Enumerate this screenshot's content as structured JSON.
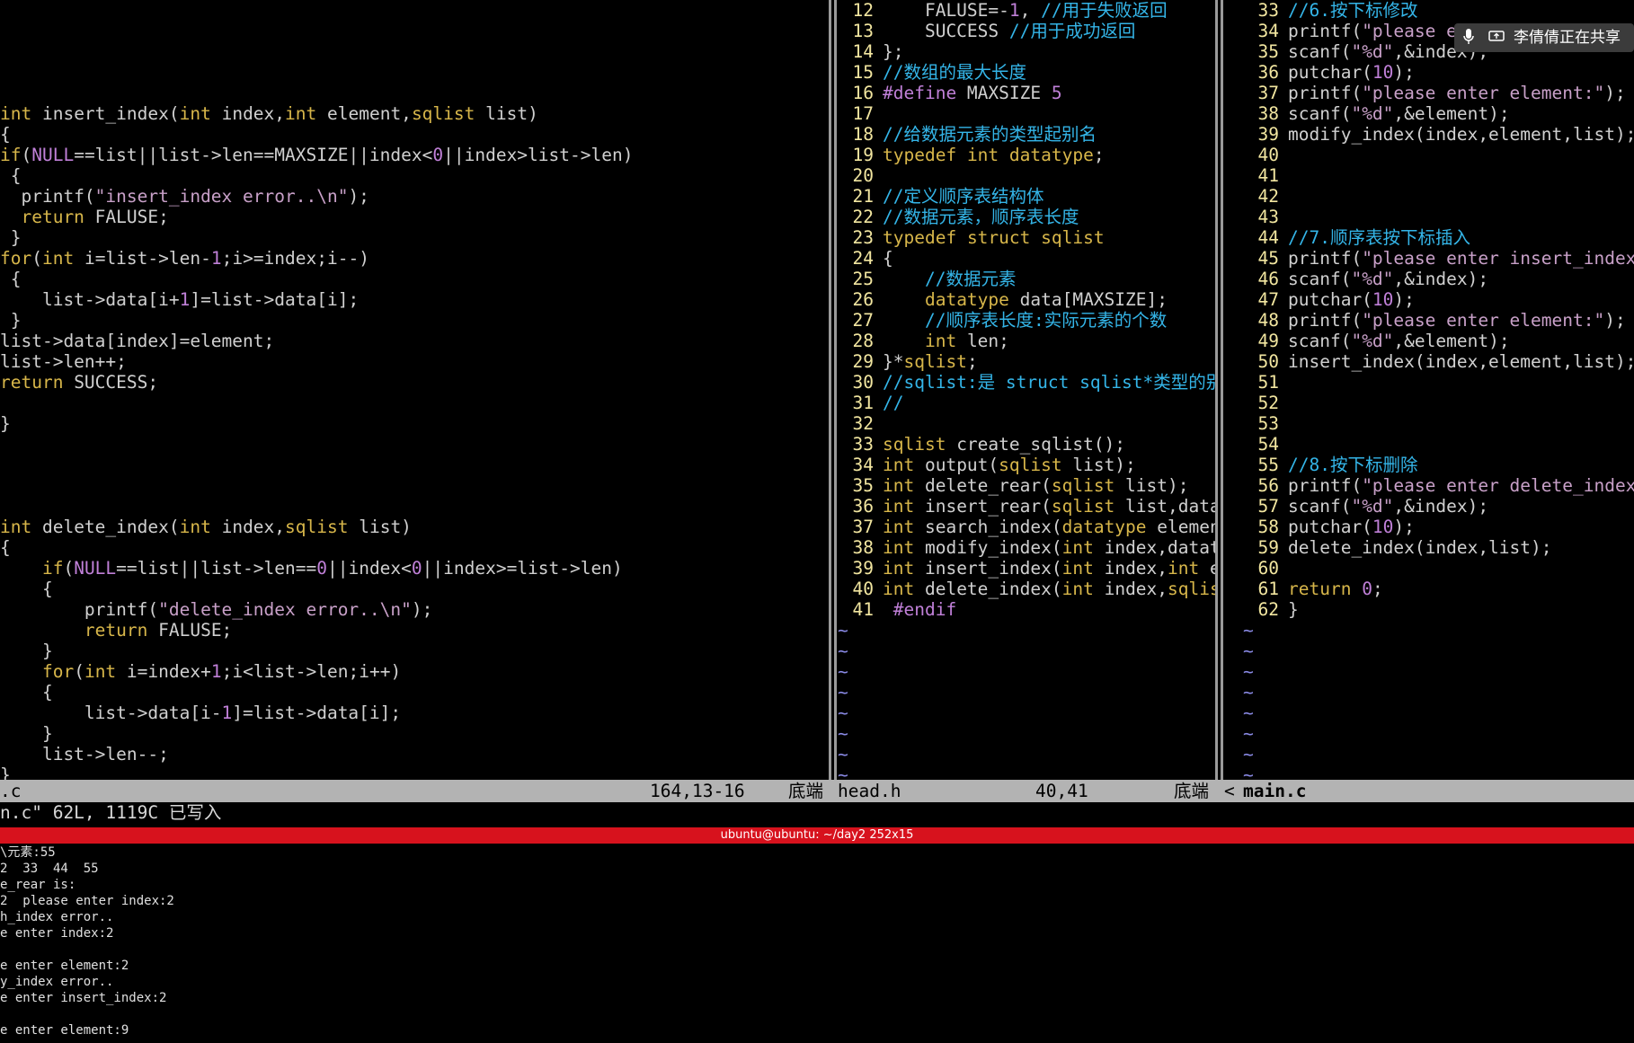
{
  "pane_left": {
    "lines": [
      "",
      "",
      "",
      "",
      "",
      "int insert_index(int index,int element,sqlist list)",
      "{",
      "if(NULL==list||list->len==MAXSIZE||index<0||index>list->len)",
      " {",
      "  printf(\"insert_index error..\\n\");",
      "  return FALUSE;",
      " }",
      "for(int i=list->len-1;i>=index;i--)",
      " {",
      "    list->data[i+1]=list->data[i];",
      " }",
      "list->data[index]=element;",
      "list->len++;",
      "return SUCCESS;",
      "",
      "}",
      "",
      "",
      "",
      "",
      "int delete_index(int index,sqlist list)",
      "{",
      "    if(NULL==list||list->len==0||index<0||index>=list->len)",
      "    {",
      "        printf(\"delete_index error..\\n\");",
      "        return FALUSE;",
      "    }",
      "    for(int i=index+1;i<list->len;i++)",
      "    {",
      "        list->data[i-1]=list->data[i];",
      "    }",
      "    list->len--;",
      "}"
    ]
  },
  "pane_mid": {
    "lines": [
      {
        "n": "12",
        "t": "    FALUSE=-1, //用于失败返回"
      },
      {
        "n": "13",
        "t": "    SUCCESS //用于成功返回"
      },
      {
        "n": "14",
        "t": "};"
      },
      {
        "n": "15",
        "t": "//数组的最大长度"
      },
      {
        "n": "16",
        "t": "#define MAXSIZE 5"
      },
      {
        "n": "17",
        "t": ""
      },
      {
        "n": "18",
        "t": "//给数据元素的类型起别名"
      },
      {
        "n": "19",
        "t": "typedef int datatype;"
      },
      {
        "n": "20",
        "t": ""
      },
      {
        "n": "21",
        "t": "//定义顺序表结构体"
      },
      {
        "n": "22",
        "t": "//数据元素，顺序表长度"
      },
      {
        "n": "23",
        "t": "typedef struct sqlist"
      },
      {
        "n": "24",
        "t": "{"
      },
      {
        "n": "25",
        "t": "    //数据元素"
      },
      {
        "n": "26",
        "t": "    datatype data[MAXSIZE];"
      },
      {
        "n": "27",
        "t": "    //顺序表长度:实际元素的个数"
      },
      {
        "n": "28",
        "t": "    int len;"
      },
      {
        "n": "29",
        "t": "}*sqlist;"
      },
      {
        "n": "30",
        "t": "//sqlist:是 struct sqlist*类型的别"
      },
      {
        "n": "31",
        "t": "//"
      },
      {
        "n": "32",
        "t": ""
      },
      {
        "n": "33",
        "t": "sqlist create_sqlist();"
      },
      {
        "n": "34",
        "t": "int output(sqlist list);"
      },
      {
        "n": "35",
        "t": "int delete_rear(sqlist list);"
      },
      {
        "n": "36",
        "t": "int insert_rear(sqlist list,dataty"
      },
      {
        "n": "37",
        "t": "int search_index(datatype element,"
      },
      {
        "n": "38",
        "t": "int modify_index(int index,datatyp"
      },
      {
        "n": "39",
        "t": "int insert_index(int index,int ele"
      },
      {
        "n": "40",
        "t": "int delete_index(int index,sqlist "
      },
      {
        "n": "41",
        "t": " #endif"
      }
    ],
    "tildes": 9
  },
  "pane_right": {
    "lines": [
      {
        "n": "33",
        "t": "//6.按下标修改"
      },
      {
        "n": "34",
        "t": "printf(\"please en"
      },
      {
        "n": "35",
        "t": "scanf(\"%d\",&index);"
      },
      {
        "n": "36",
        "t": "putchar(10);"
      },
      {
        "n": "37",
        "t": "printf(\"please enter element:\");"
      },
      {
        "n": "38",
        "t": "scanf(\"%d\",&element);"
      },
      {
        "n": "39",
        "t": "modify_index(index,element,list);"
      },
      {
        "n": "40",
        "t": ""
      },
      {
        "n": "41",
        "t": ""
      },
      {
        "n": "42",
        "t": ""
      },
      {
        "n": "43",
        "t": ""
      },
      {
        "n": "44",
        "t": "//7.顺序表按下标插入"
      },
      {
        "n": "45",
        "t": "printf(\"please enter insert_index:\")"
      },
      {
        "n": "46",
        "t": "scanf(\"%d\",&index);"
      },
      {
        "n": "47",
        "t": "putchar(10);"
      },
      {
        "n": "48",
        "t": "printf(\"please enter element:\");"
      },
      {
        "n": "49",
        "t": "scanf(\"%d\",&element);"
      },
      {
        "n": "50",
        "t": "insert_index(index,element,list);"
      },
      {
        "n": "51",
        "t": ""
      },
      {
        "n": "52",
        "t": ""
      },
      {
        "n": "53",
        "t": ""
      },
      {
        "n": "54",
        "t": ""
      },
      {
        "n": "55",
        "t": "//8.按下标删除"
      },
      {
        "n": "56",
        "t": "printf(\"please enter delete_index:\")"
      },
      {
        "n": "57",
        "t": "scanf(\"%d\",&index);"
      },
      {
        "n": "58",
        "t": "putchar(10);"
      },
      {
        "n": "59",
        "t": "delete_index(index,list);"
      },
      {
        "n": "60",
        "t": ""
      },
      {
        "n": "61",
        "t": "return 0;"
      },
      {
        "n": "62",
        "t": "}"
      }
    ],
    "tildes": 9
  },
  "statusbar": {
    "left_file": ".c",
    "left_pos": "164,13-16",
    "left_pct": "底端",
    "mid_file": "head.h",
    "mid_pos": "40,41",
    "mid_pct": "底端",
    "right_arrow": "<",
    "right_file": "main.c"
  },
  "cmdline": "n.c\" 62L, 1119C 已写入",
  "terminal": {
    "title": "ubuntu@ubuntu: ~/day2 252x15",
    "lines": [
      "\\元素:55",
      "2  33  44  55",
      "e_rear is:",
      "2  please enter index:2",
      "h_index error..",
      "e enter index:2",
      "",
      "e enter element:2",
      "y_index error..",
      "e enter insert_index:2",
      "",
      "e enter element:9"
    ]
  },
  "share_badge": {
    "label": "李倩倩正在共享"
  },
  "colors": {
    "keyword": "#d7b64a",
    "type": "#8ae234",
    "comment": "#34b5e8",
    "string": "#c8a0c8",
    "number": "#c080d8",
    "linenumber": "#f2e6a0",
    "tilde": "#8a8ae6",
    "terminal_bar": "#d7121d"
  }
}
